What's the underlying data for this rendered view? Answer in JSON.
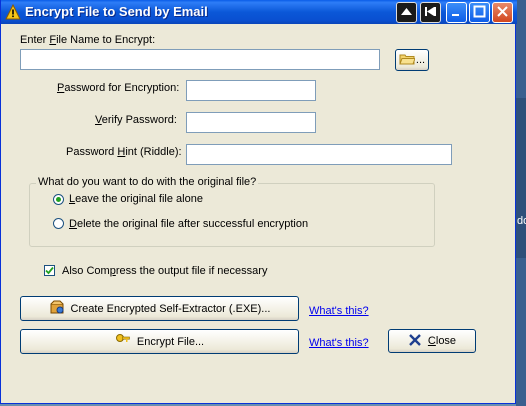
{
  "window": {
    "title": "Encrypt File to Send by Email"
  },
  "form": {
    "file_label_pre": "Enter ",
    "file_label_key": "F",
    "file_label_post": "ile Name to Encrypt:",
    "file_value": "",
    "browse_label": "...",
    "pw_label_pre": "",
    "pw_label_key": "P",
    "pw_label_post": "assword for Encryption:",
    "pw_value": "",
    "verify_label_pre": "",
    "verify_label_key": "V",
    "verify_label_post": "erify Password:",
    "verify_value": "",
    "hint_label_pre": "Password ",
    "hint_label_key": "H",
    "hint_label_post": "int (Riddle):",
    "hint_value": ""
  },
  "original_file_group": {
    "legend": "What do you want to do with the original file?",
    "options": [
      {
        "pre": "",
        "key": "L",
        "post": "eave the original file alone",
        "selected": true
      },
      {
        "pre": "",
        "key": "D",
        "post": "elete the original file after successful encryption",
        "selected": false
      }
    ]
  },
  "compress": {
    "pre": "Also Com",
    "key": "p",
    "post": "ress the output file if necessary",
    "checked": true
  },
  "actions": {
    "self_extractor_label": "Create Encrypted Self-Extractor (.EXE)...",
    "whats_this_1": "What's this?",
    "encrypt_label": "Encrypt File...",
    "whats_this_2": "What's this?",
    "close_pre": "",
    "close_key": "C",
    "close_post": "lose"
  },
  "desktop": {
    "edge_text": "do"
  },
  "colors": {
    "titlebar": "#0a5ce8",
    "window_bg": "#ece9d8",
    "link": "#0000ee",
    "radio_dot": "#21a121"
  }
}
